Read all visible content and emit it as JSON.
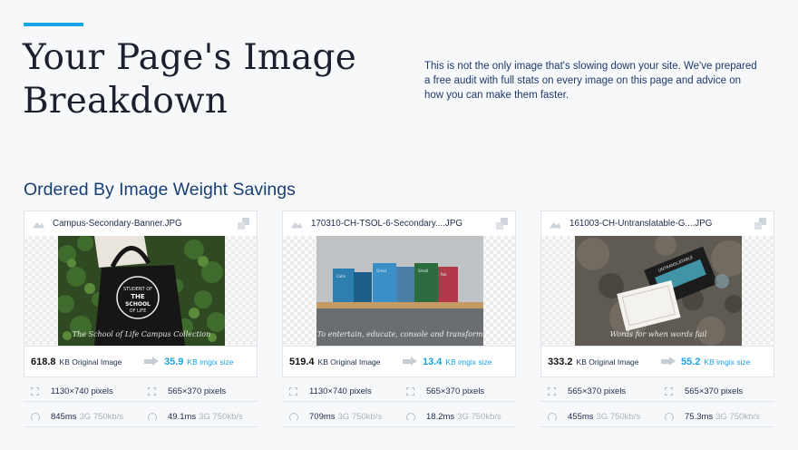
{
  "header": {
    "title": "Your Page's Image Breakdown",
    "intro": "This is not the only image that's slowing down your site. We've prepared a free audit with full stats on every image on this page and advice on how you can make them faster."
  },
  "section": {
    "heading": "Ordered By Image Weight Savings"
  },
  "colors": {
    "accent": "#1aa3e6",
    "heading": "#1a3f75"
  },
  "cards": [
    {
      "filename": "Campus-Secondary-Banner.JPG",
      "image_caption": "The School of Life Campus Collection",
      "original_size": "618.8",
      "original_label": "KB Original Image",
      "imgix_size": "35.9",
      "imgix_label": "KB imgix size",
      "original_dims": "1130×740 pixels",
      "imgix_dims": "565×370 pixels",
      "original_time": "845ms",
      "imgix_time": "49.1ms",
      "network": "3G 750kb/s"
    },
    {
      "filename": "170310-CH-TSOL-6-Secondary....JPG",
      "image_caption": "To entertain, educate, console and transform",
      "original_size": "519.4",
      "original_label": "KB Original Image",
      "imgix_size": "13.4",
      "imgix_label": "KB imgix size",
      "original_dims": "1130×740 pixels",
      "imgix_dims": "565×370 pixels",
      "original_time": "709ms",
      "imgix_time": "18.2ms",
      "network": "3G 750kb/s"
    },
    {
      "filename": "161003-CH-Untranslatable-G....JPG",
      "image_caption": "Words for when words fail",
      "original_size": "333.2",
      "original_label": "KB Original Image",
      "imgix_size": "55.2",
      "imgix_label": "KB imgix size",
      "original_dims": "565×370 pixels",
      "imgix_dims": "565×370 pixels",
      "original_time": "455ms",
      "imgix_time": "75.3ms",
      "network": "3G 750kb/s"
    }
  ]
}
